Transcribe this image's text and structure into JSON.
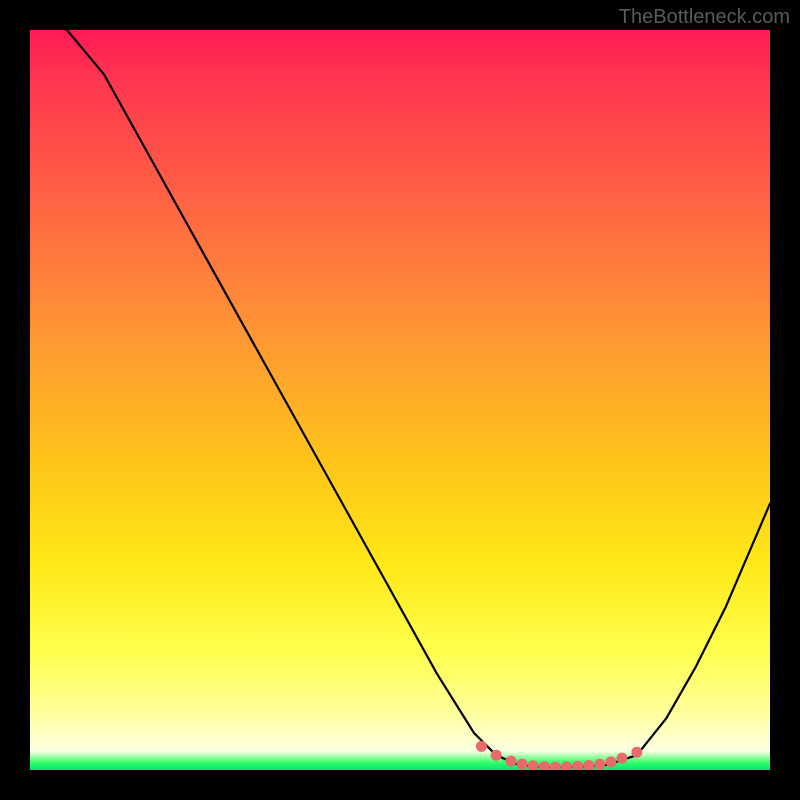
{
  "attribution": "TheBottleneck.com",
  "chart_data": {
    "type": "line",
    "title": "",
    "xlabel": "",
    "ylabel": "",
    "xlim": [
      0,
      100
    ],
    "ylim": [
      0,
      100
    ],
    "series": [
      {
        "name": "bottleneck-curve",
        "x": [
          0,
          5,
          10,
          15,
          20,
          25,
          30,
          35,
          40,
          45,
          50,
          55,
          60,
          63,
          66,
          69,
          72,
          75,
          78,
          82,
          86,
          90,
          94,
          100
        ],
        "values": [
          102,
          100,
          94,
          85,
          76,
          67,
          58,
          49,
          40,
          31,
          22,
          13,
          5,
          2,
          0.7,
          0.4,
          0.4,
          0.5,
          0.7,
          2,
          7,
          14,
          22,
          36
        ]
      }
    ],
    "markers": {
      "name": "highlight-dots",
      "x": [
        61,
        63,
        65,
        66.5,
        68,
        69.5,
        71,
        72.5,
        74,
        75.5,
        77,
        78.5,
        80,
        82
      ],
      "values": [
        3.2,
        2.0,
        1.2,
        0.8,
        0.55,
        0.45,
        0.4,
        0.42,
        0.5,
        0.6,
        0.8,
        1.1,
        1.6,
        2.4
      ]
    },
    "background": {
      "type": "vertical-gradient",
      "stops": [
        {
          "pct": 0,
          "color": "#ff1a55"
        },
        {
          "pct": 50,
          "color": "#ffaa22"
        },
        {
          "pct": 85,
          "color": "#ffff55"
        },
        {
          "pct": 100,
          "color": "#00e676"
        }
      ]
    }
  }
}
